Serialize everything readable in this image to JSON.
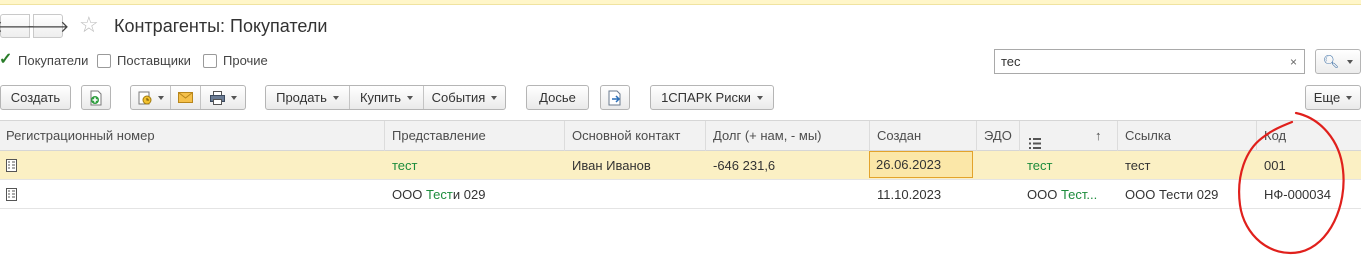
{
  "window": {
    "title": "Контрагенты: Покупатели"
  },
  "filters": [
    {
      "label": "Покупатели",
      "checked": true
    },
    {
      "label": "Поставщики",
      "checked": false
    },
    {
      "label": "Прочие",
      "checked": false
    }
  ],
  "search": {
    "value": "тес",
    "clear": "×"
  },
  "toolbar": {
    "create": "Создать",
    "sell": "Продать",
    "buy": "Купить",
    "events": "События",
    "dossier": "Досье",
    "spark": "1СПАРК Риски",
    "more": "Еще"
  },
  "table": {
    "columns": [
      "Регистрационный номер",
      "Представление",
      "Основной контакт",
      "Долг (+ нам, - мы)",
      "Создан",
      "ЭДО",
      "",
      "Ссылка",
      "Код"
    ],
    "sort_indicator": "↑",
    "rows": [
      {
        "reg": "",
        "name": "тест",
        "contact": "Иван Иванов",
        "debt": "-646 231,6",
        "created": "26.06.2023",
        "edo": "",
        "list": "тест",
        "link": "тест",
        "code": "001",
        "selected": true
      },
      {
        "reg": "",
        "name_prefix": "ООО ",
        "name_match": "Тест",
        "name_suffix": "и 029",
        "contact": "",
        "debt": "",
        "created": "11.10.2023",
        "edo": "",
        "list_prefix": "ООО ",
        "list_match": "Тест...",
        "link": "ООО Тести 029",
        "code": "НФ-000034",
        "selected": false
      }
    ]
  },
  "colors": {
    "highlight": "#1c8c3c",
    "selected_row": "#fbf0c4",
    "annotation": "#e0201c"
  }
}
